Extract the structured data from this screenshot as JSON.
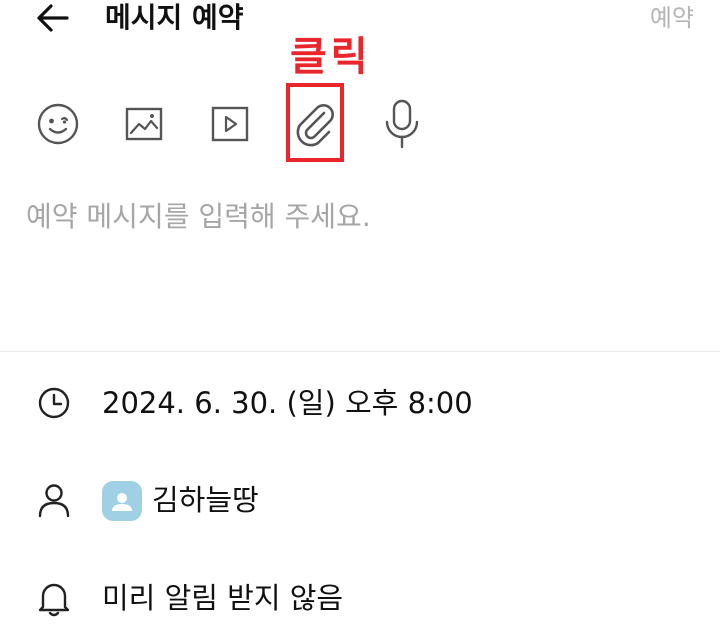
{
  "header": {
    "back_icon": "arrow-left-icon",
    "title": "메시지 예약",
    "reserve_label": "예약"
  },
  "annotation": {
    "label": "클릭",
    "color": "#e8262b"
  },
  "toolbar": {
    "items": [
      {
        "icon": "emoticon-icon"
      },
      {
        "icon": "image-icon"
      },
      {
        "icon": "video-icon"
      },
      {
        "icon": "attachment-icon"
      },
      {
        "icon": "microphone-icon"
      }
    ]
  },
  "message": {
    "placeholder": "예약 메시지를 입력해 주세요.",
    "value": ""
  },
  "schedule": {
    "icon": "clock-icon",
    "datetime": "2024. 6. 30. (일) 오후 8:00"
  },
  "recipient": {
    "icon": "person-icon",
    "avatar_color": "#9fd0e3",
    "name": "김하늘땅"
  },
  "notification": {
    "icon": "bell-icon",
    "label": "미리 알림 받지 않음"
  },
  "colors": {
    "text": "#111111",
    "muted": "#a6a6a6",
    "icon": "#555555",
    "highlight": "#e8262b"
  }
}
